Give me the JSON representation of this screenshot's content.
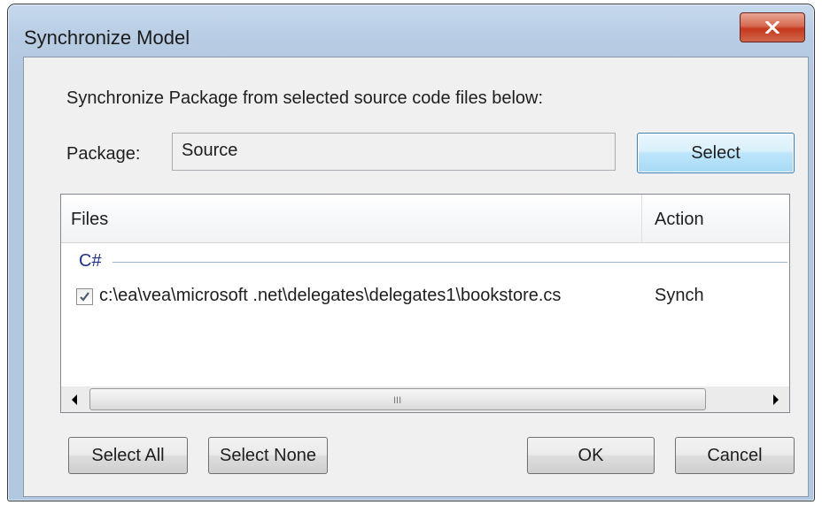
{
  "window": {
    "title": "Synchronize Model",
    "close_icon": "close-x-icon"
  },
  "dialog": {
    "instruction": "Synchronize Package from selected source code files below:",
    "package_label": "Package:",
    "package_value": "Source",
    "select_label": "Select"
  },
  "list": {
    "columns": [
      "Files",
      "Action"
    ],
    "group": "C#",
    "rows": [
      {
        "checked": true,
        "file": "c:\\ea\\vea\\microsoft .net\\delegates\\delegates1\\bookstore.cs",
        "action": "Synch"
      }
    ],
    "scrollbar_grip": "III"
  },
  "buttons": {
    "select_all": "Select All",
    "select_none": "Select None",
    "ok": "OK",
    "cancel": "Cancel"
  },
  "colors": {
    "frame": "#b2c8e0",
    "client": "#f0f0f0",
    "close_button": "#c4391d",
    "group_text": "#1e3287",
    "select_button": "#a7d9f5"
  }
}
